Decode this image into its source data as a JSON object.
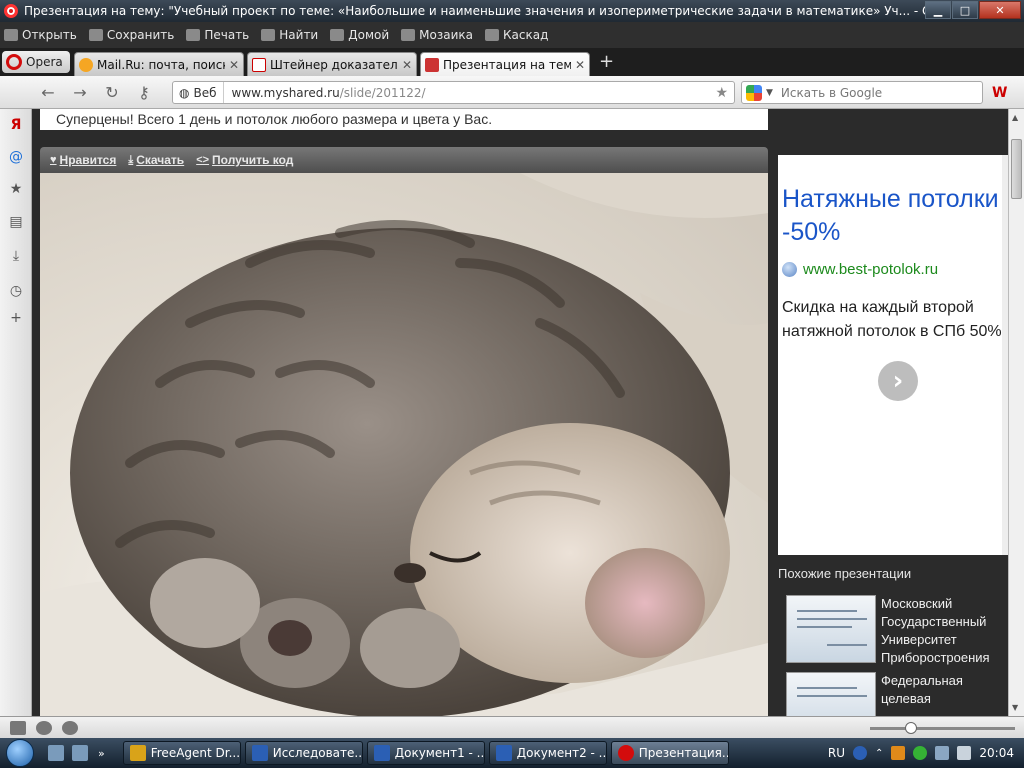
{
  "window": {
    "title": "Презентация на тему: \"Учебный проект по теме: «Наибольшие и наименьшие значения и изопериметрические задачи в математике» Уч... - Opera",
    "controls": [
      "minimize",
      "maximize",
      "close"
    ]
  },
  "menubar": {
    "items": [
      {
        "label": "Открыть",
        "icon": "folder-icon"
      },
      {
        "label": "Сохранить",
        "icon": "save-icon"
      },
      {
        "label": "Печать",
        "icon": "print-icon"
      },
      {
        "label": "Найти",
        "icon": "search-icon"
      },
      {
        "label": "Домой",
        "icon": "home-icon"
      },
      {
        "label": "Мозаика",
        "icon": "tile-icon"
      },
      {
        "label": "Каскад",
        "icon": "cascade-icon"
      }
    ]
  },
  "tabs": {
    "opera_button": "Opera",
    "items": [
      {
        "label": "Mail.Ru: почта, поиск ...",
        "active": false
      },
      {
        "label": "Штейнер доказательст...",
        "active": false
      },
      {
        "label": "Презентация на тему: ...",
        "active": true
      }
    ],
    "new_tab": "+"
  },
  "address": {
    "web_label": "Веб",
    "url_domain": "www.myshared.ru",
    "url_path": "/slide/201122/",
    "search_placeholder": "Искать в Google"
  },
  "page": {
    "promo_text": "Суперцены! Всего 1 день и потолок любого размера и цвета у Вас.",
    "toolbar": {
      "like": "Нравится",
      "download": "Скачать",
      "embed": "Получить код"
    },
    "ad": {
      "title": "Натяжные потолки -50%",
      "url": "www.best-potolok.ru",
      "description": "Скидка на каждый второй натяжной потолок в СПб 50%"
    },
    "similar": {
      "heading": "Похожие презентации",
      "items": [
        {
          "name": "Московский Государственный Университет Приборостроения"
        },
        {
          "name": "Федеральная целевая"
        }
      ]
    }
  },
  "taskbar": {
    "tasks": [
      {
        "label": "FreeAgent Dr...",
        "color": "#d9a319"
      },
      {
        "label": "Исследовате...",
        "color": "#2b5fb4"
      },
      {
        "label": "Документ1 - ...",
        "color": "#2b5fb4"
      },
      {
        "label": "Документ2 - ...",
        "color": "#2b5fb4"
      },
      {
        "label": "Презентация...",
        "color": "#d30c0c"
      }
    ],
    "language": "RU",
    "clock": "20:04"
  }
}
